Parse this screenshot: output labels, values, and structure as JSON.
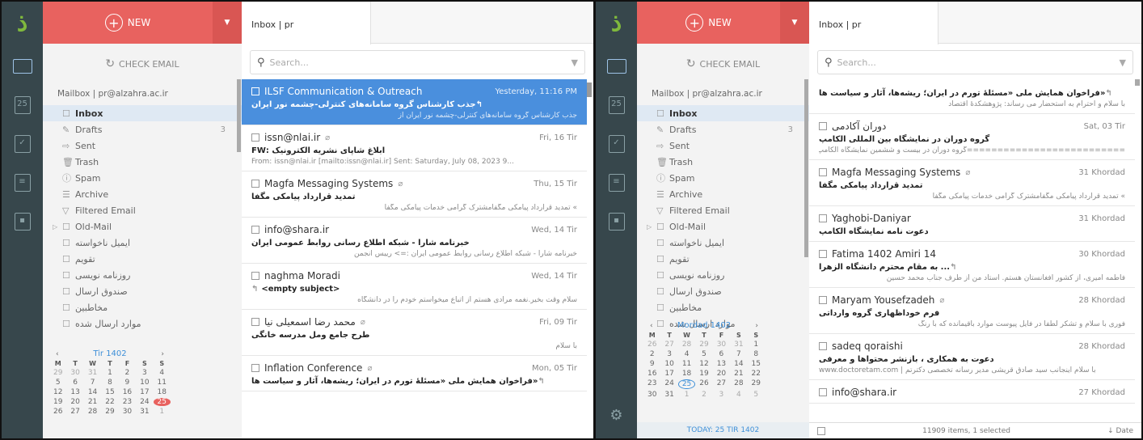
{
  "colors": {
    "accent": "#3d8fd8",
    "brand_red": "#e8625f",
    "rail": "#37474c",
    "selected": "#4a8fdd"
  },
  "left": {
    "new_label": "NEW",
    "check_email": "CHECK EMAIL",
    "mailbox": "Mailbox | pr@alzahra.ac.ir",
    "folders": [
      {
        "label": "Inbox",
        "icon": "inbox-icon",
        "active": true
      },
      {
        "label": "Drafts",
        "icon": "drafts-icon",
        "count": "3"
      },
      {
        "label": "Sent",
        "icon": "sent-icon"
      },
      {
        "label": "Trash",
        "icon": "trash-icon"
      },
      {
        "label": "Spam",
        "icon": "spam-icon"
      },
      {
        "label": "Archive",
        "icon": "archive-icon"
      },
      {
        "label": "Filtered Email",
        "icon": "filter-icon"
      },
      {
        "label": "Old-Mail",
        "icon": "folder-icon"
      },
      {
        "label": "ایمیل ناخواسته",
        "icon": "folder-icon"
      },
      {
        "label": "تقویم",
        "icon": "folder-icon"
      },
      {
        "label": "روزنامه نویسی",
        "icon": "folder-icon"
      },
      {
        "label": "صندوق ارسال",
        "icon": "folder-icon"
      },
      {
        "label": "مخاطبین",
        "icon": "folder-icon"
      },
      {
        "label": "موارد ارسال شده",
        "icon": "folder-icon"
      }
    ],
    "calendar": {
      "month": "Tir 1402",
      "weekdays": [
        "M",
        "T",
        "W",
        "T",
        "F",
        "S",
        "S"
      ],
      "days": [
        "29",
        "30",
        "31",
        "1",
        "2",
        "3",
        "4",
        "5",
        "6",
        "7",
        "8",
        "9",
        "10",
        "11",
        "12",
        "13",
        "14",
        "15",
        "16",
        "17",
        "18",
        "19",
        "20",
        "21",
        "22",
        "23",
        "24",
        "25",
        "26",
        "27",
        "28",
        "29",
        "30",
        "31",
        "1"
      ],
      "today": "25"
    },
    "tab": "Inbox | pr",
    "search_placeholder": "Search...",
    "messages": [
      {
        "from": "ILSF Communication & Outreach",
        "date": "Yesterday, 11:16 PM",
        "subject": "جذب کارشناس گروه سامانه‌های کنترلی-چشمه نور ایران",
        "preview": "جذب کارشناس گروه سامانه‌های کنترلی-چشمه نور ایران از",
        "selected": true,
        "reply": true
      },
      {
        "from": "issn@nlai.ir",
        "date": "Fri, 16 Tir",
        "subject": "ابلاغ شاپای نشریه الکترونیک :FW",
        "preview": "From: issn@nlai.ir [mailto:issn@nlai.ir] Sent: Saturday, July 08, 2023 9...",
        "clip": true
      },
      {
        "from": "Magfa Messaging Systems",
        "date": "Thu, 15 Tir",
        "subject": "تمدید قرارداد پیامکی مگفا",
        "preview": "» تمدید قرارداد پیامکی مگفامشترک گرامی خدمات پیامکی مگفا",
        "clip": true
      },
      {
        "from": "info@shara.ir",
        "date": "Wed, 14 Tir",
        "subject": "خبرنامه شارا - شبکه اطلاع رسانی روابط عمومی ایران",
        "preview": "خبرنامه شارا - شبکه اطلاع رسانی روابط عمومی ایران :=> رییس انجمن"
      },
      {
        "from": "naghma Moradi",
        "date": "Wed, 14 Tir",
        "subject": "<empty subject>",
        "preview": "سلام وقت بخیر.نغمه مرادی هستم از اتباع میخواستم خودم را در دانشگاه",
        "reply": true
      },
      {
        "from": "محمد رضا اسمعیلی نیا",
        "date": "Fri, 09 Tir",
        "subject": "طرح جامع ومل مدرسه خانگی",
        "preview": "با سلام",
        "clip": true
      },
      {
        "from": "Inflation Conference",
        "date": "Mon, 05 Tir",
        "subject": "«فراخوان همایش ملی «مسئلهٔ تورم در ایران؛ ریشه‌ها، آثار و سیاست ها",
        "preview": "",
        "clip": true,
        "reply": true
      }
    ]
  },
  "right": {
    "new_label": "NEW",
    "check_email": "CHECK EMAIL",
    "mailbox": "Mailbox | pr@alzahra.ac.ir",
    "folders": [
      {
        "label": "Inbox",
        "icon": "inbox-icon",
        "active": true
      },
      {
        "label": "Drafts",
        "icon": "drafts-icon",
        "count": "3"
      },
      {
        "label": "Sent",
        "icon": "sent-icon"
      },
      {
        "label": "Trash",
        "icon": "trash-icon"
      },
      {
        "label": "Spam",
        "icon": "spam-icon"
      },
      {
        "label": "Archive",
        "icon": "archive-icon"
      },
      {
        "label": "Filtered Email",
        "icon": "filter-icon"
      },
      {
        "label": "Old-Mail",
        "icon": "folder-icon"
      },
      {
        "label": "ایمیل ناخواسته",
        "icon": "folder-icon"
      },
      {
        "label": "تقویم",
        "icon": "folder-icon"
      },
      {
        "label": "روزنامه نویسی",
        "icon": "folder-icon"
      },
      {
        "label": "صندوق ارسال",
        "icon": "folder-icon"
      },
      {
        "label": "مخاطبین",
        "icon": "folder-icon"
      },
      {
        "label": "موارد ارسال شده",
        "icon": "folder-icon"
      }
    ],
    "calendar": {
      "month": "Mordad 1402",
      "weekdays": [
        "M",
        "T",
        "W",
        "T",
        "F",
        "S",
        "S"
      ],
      "days": [
        "26",
        "27",
        "28",
        "29",
        "30",
        "31",
        "1",
        "2",
        "3",
        "4",
        "5",
        "6",
        "7",
        "8",
        "9",
        "10",
        "11",
        "12",
        "13",
        "14",
        "15",
        "16",
        "17",
        "18",
        "19",
        "20",
        "21",
        "22",
        "23",
        "24",
        "25",
        "26",
        "27",
        "28",
        "29",
        "30",
        "31",
        "1",
        "2",
        "3",
        "4",
        "5"
      ],
      "today": "25"
    },
    "today_label": "TODAY: 25 TIR 1402",
    "tab": "Inbox | pr",
    "search_placeholder": "Search...",
    "messages": [
      {
        "from": "",
        "date": "",
        "subject": "«فراخوان همایش ملی «مسئلهٔ تورم در ایران؛ ریشه‌ها، آثار و سیاست ها",
        "preview": "با سلام و احترام به استحضار می رساند: پژوهشکدهٔ اقتصاد",
        "reply": true
      },
      {
        "from": "دوران آکادمی",
        "date": "Sat, 03 Tir",
        "subject": "گروه دوران در نمایشگاه بین المللی الکامپ",
        "preview": "==========================گروه دوران در بیست و ششمین نمایشگاه الکامپ ..."
      },
      {
        "from": "Magfa Messaging Systems",
        "date": "31 Khordad",
        "subject": "تمدید قرارداد پیامکی مگفا",
        "preview": "» تمدید قرارداد پیامکی مگفامشترک گرامی خدمات پیامکی مگفا",
        "clip": true
      },
      {
        "from": "Yaghobi-Daniyar",
        "date": "31 Khordad",
        "subject": "دعوت نامه نمایشگاه الکامپ",
        "preview": ""
      },
      {
        "from": "Fatima 1402 Amiri 14",
        "date": "30 Khordad",
        "subject": "... به مقام محترم دانشگاه الزهرا",
        "preview": "فاطمه امیری، از کشور افغانستان هستم. استاد من از طرف جناب محمد حسین",
        "reply": true
      },
      {
        "from": "Maryam Yousefzadeh",
        "date": "28 Khordad",
        "subject": "فرم خوداظهاری گروه وارداتی",
        "preview": "فوری با سلام و تشکر لطفا در فایل پیوست موارد باقیمانده که با رنگ",
        "clip": true
      },
      {
        "from": "sadeq qoraishi",
        "date": "28 Khordad",
        "subject": "دعوت به همکاری ، بازنشر محتواها و معرفی",
        "preview": "www.doctoretam.com | با سلام اینجانب سید صادق قریشی مدیر رسانه تخصصی دکترتم"
      },
      {
        "from": "info@shara.ir",
        "date": "27 Khordad",
        "subject": "",
        "preview": ""
      }
    ],
    "status_count": "11909 items, 1 selected",
    "sort_label": "↓ Date"
  }
}
